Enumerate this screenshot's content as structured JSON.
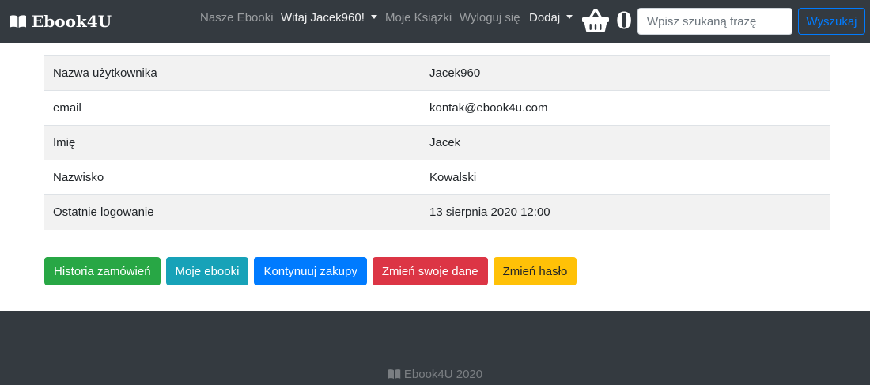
{
  "navbar": {
    "brand": "Ebook4U",
    "links": {
      "our_ebooks": "Nasze Ebooki",
      "greeting": "Witaj Jacek960!",
      "my_books": "Moje Książki",
      "logout": "Wyloguj się",
      "add": "Dodaj"
    },
    "cart_count": "0",
    "search": {
      "placeholder": "Wpisz szukaną frazę",
      "button": "Wyszukaj"
    }
  },
  "profile": {
    "rows": [
      {
        "label": "Nazwa użytkownika",
        "value": "Jacek960"
      },
      {
        "label": "email",
        "value": "kontak@ebook4u.com"
      },
      {
        "label": "Imię",
        "value": "Jacek"
      },
      {
        "label": "Nazwisko",
        "value": "Kowalski"
      },
      {
        "label": "Ostatnie logowanie",
        "value": "13 sierpnia 2020 12:00"
      }
    ]
  },
  "actions": {
    "order_history": "Historia zamówień",
    "my_ebooks": "Moje ebooki",
    "continue_shopping": "Kontynuuj zakupy",
    "edit_data": "Zmień swoje dane",
    "change_password": "Zmień hasło"
  },
  "footer": {
    "text": "Ebook4U 2020"
  },
  "colors": {
    "navbar_bg": "#343a40",
    "success": "#28a745",
    "info": "#17a2b8",
    "primary": "#007bff",
    "danger": "#dc3545",
    "warning": "#ffc107",
    "stripe": "#f2f2f2"
  },
  "icons": {
    "brand": "book-open-icon",
    "cart": "shopping-basket-icon",
    "footer": "book-open-icon"
  }
}
